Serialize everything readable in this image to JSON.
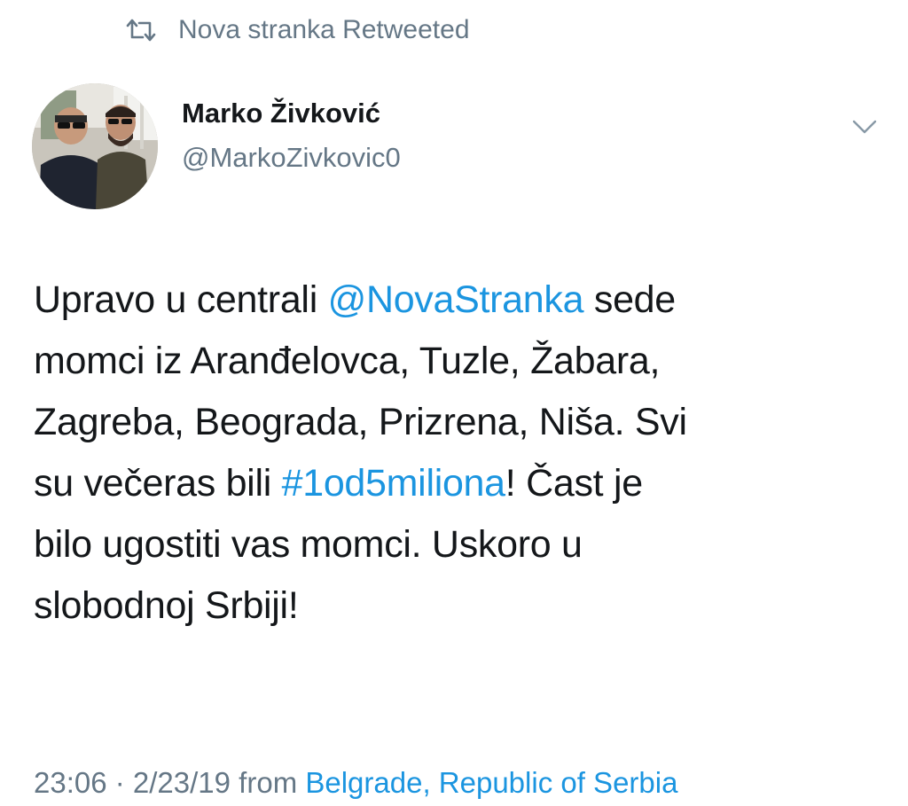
{
  "retweet": {
    "icon": "retweet-icon",
    "text": "Nova stranka Retweeted"
  },
  "author": {
    "display_name": "Marko Živković",
    "handle": "@MarkoZivkovic0",
    "avatar_icon": "avatar-photo"
  },
  "caret_icon": "chevron-down-icon",
  "tweet": {
    "line1_pre": "Upravo u centrali ",
    "mention": "@NovaStranka",
    "line1_post": " sede",
    "line2": "momci iz Aranđelovca, Tuzle,  Žabara,",
    "line3": "Zagreba, Beograda, Prizrena, Niša. Svi",
    "line4_pre": "su večeras bili ",
    "hashtag": "#1od5miliona",
    "line4_post": "! Čast je",
    "line5": "bilo ugostiti vas momci. Uskoro u",
    "line6": "slobodnoj Srbiji!"
  },
  "meta": {
    "time_date": "23:06 · 2/23/19 from ",
    "place": "Belgrade, Republic of Serbia"
  },
  "colors": {
    "link": "#1b95e0",
    "secondary_text": "#657786",
    "primary_text": "#14171a"
  }
}
